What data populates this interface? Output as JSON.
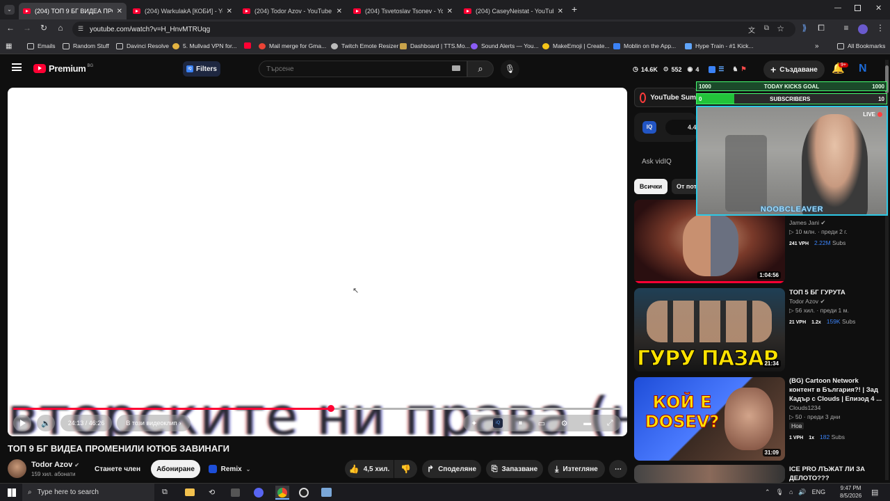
{
  "tabs": [
    {
      "label": "(204) ТОП 9 БГ ВИДЕА ПРОМЕН",
      "active": true
    },
    {
      "label": "(204) WarkulakA [КОБИ] - YouT",
      "active": false
    },
    {
      "label": "(204) Todor Azov - YouTube",
      "active": false
    },
    {
      "label": "(204) Tsvetoslav Tsonev - YouTu",
      "active": false
    },
    {
      "label": "(204) CaseyNeistat - YouTube",
      "active": false
    }
  ],
  "url": "youtube.com/watch?v=H_HnvMTRUqg",
  "bookmarks": [
    {
      "label": "Emails",
      "icon": "folder-icon"
    },
    {
      "label": "Random Stuff",
      "icon": "folder-icon"
    },
    {
      "label": "Davinci Resolve",
      "icon": "folder-icon"
    },
    {
      "label": "5. Mullvad VPN for...",
      "icon": "mullvad-icon"
    },
    {
      "label": "",
      "icon": "youtube-icon"
    },
    {
      "label": "Mail merge for Gma...",
      "icon": "mail-icon"
    },
    {
      "label": "Twitch Emote Resizer",
      "icon": "globe-icon"
    },
    {
      "label": "Dashboard | TTS.Mo...",
      "icon": "tts-icon"
    },
    {
      "label": "Sound Alerts — You...",
      "icon": "sound-icon"
    },
    {
      "label": "MakeEmoji | Create...",
      "icon": "emoji-icon"
    },
    {
      "label": "Moblin on the App...",
      "icon": "app-icon"
    },
    {
      "label": "Hype Train - #1 Kick...",
      "icon": "shield-icon"
    }
  ],
  "all_bookmarks": "All Bookmarks",
  "yt": {
    "logo": "Premium",
    "region": "BG",
    "filters": "Filters",
    "search_placeholder": "Търсене",
    "stats": {
      "views": "14.6K",
      "likes": "552",
      "watching": "4"
    },
    "create": "Създаване",
    "notif_count": "9+"
  },
  "player": {
    "subtitle_text": "вторските ни права (не",
    "progress": 0.523,
    "time": "24:13 / 46:26",
    "chapter": "В този видеоклип"
  },
  "video": {
    "title": "ТОП 9 БГ ВИДЕА ПРОМЕНИЛИ ЮТЮБ ЗАВИНАГИ",
    "channel": "Todor Azov",
    "subscribers": "159 хил. абонати",
    "join": "Станете член",
    "subscribe": "Абониране",
    "remix": "Remix",
    "likes": "4,5 хил.",
    "share": "Споделяне",
    "save": "Запазване",
    "download": "Изтегляне"
  },
  "sidebar": {
    "summary": "YouTube Sum",
    "ask": "Ask vidIQ",
    "score": "4.4",
    "chips": [
      "Всички",
      "От пот"
    ],
    "videos": [
      {
        "channel": "James Jani",
        "views": "10 млн.",
        "age": "преди 2 г.",
        "vph": "241 VPH",
        "subs": "2.22M",
        "subs_label": "Subs",
        "duration": "1:04:56"
      },
      {
        "title": "ТОП 5 БГ ГУРУТА",
        "channel": "Todor Azov",
        "views": "56 хил.",
        "age": "преди 1 м.",
        "vph": "21 VPH",
        "mult": "1.2x",
        "subs": "159K",
        "subs_label": "Subs",
        "duration": "21:34",
        "thumb_text": "ГУРУ ПАЗАР"
      },
      {
        "title": "(BG) Cartoon Network контент в България?! | Зад Кадър с Clouds | Епизод 4 ...",
        "channel": "Clouds1234",
        "views": "50",
        "age": "преди 3 дни",
        "tag": "Нов",
        "vph": "1 VPH",
        "mult": "1x",
        "subs": "182",
        "subs_label": "Subs",
        "duration": "31:09",
        "thumb_text": "КОЙ Е DOSEV?"
      },
      {
        "title": "ICE PRO ЛЪЖАТ ЛИ ЗА ДЕЛОТО???"
      }
    ]
  },
  "overlay": {
    "goal_left": "1000",
    "goal_title": "TODAY KICKS GOAL",
    "goal_right": "1000",
    "subs_left": "0",
    "subs_title": "SUBSCRIBERS",
    "subs_right": "10",
    "live": "LIVE",
    "name": "NOOBCLEAVER"
  },
  "taskbar": {
    "search": "Type here to search",
    "lang": "ENG",
    "time": "9:47 PM",
    "date": "8/5/2026"
  }
}
